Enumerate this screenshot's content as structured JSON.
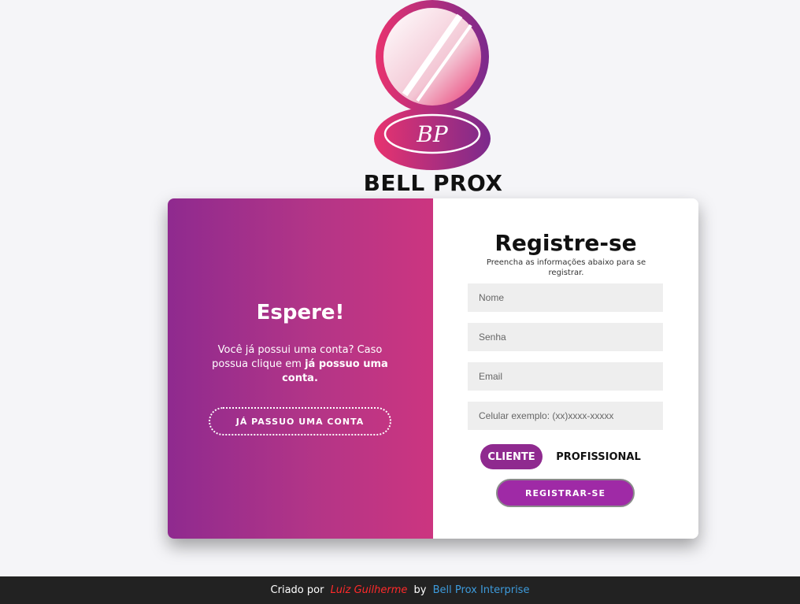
{
  "brand": {
    "name": "BELL PROX",
    "logo_monogram": "BP",
    "colors": {
      "pink": "#e8336f",
      "purple": "#8f2a8f"
    }
  },
  "left_panel": {
    "title": "Espere!",
    "text_pre": "Você já possui uma conta? Caso possua clique em",
    "text_bold": "já possuo uma conta.",
    "button_label": "JÁ PASSUO UMA CONTA"
  },
  "right_panel": {
    "title": "Registre-se",
    "subtitle": "Preencha as informações abaixo para se registrar.",
    "fields": [
      {
        "placeholder": "Nome",
        "value": ""
      },
      {
        "placeholder": "Senha",
        "value": ""
      },
      {
        "placeholder": "Email",
        "value": ""
      },
      {
        "placeholder": "Celular exemplo: (xx)xxxx-xxxxx",
        "value": ""
      }
    ],
    "toggle": {
      "client": "CLIENTE",
      "professional": "PROFISSIONAL",
      "selected": "CLIENTE"
    },
    "submit_label": "REGISTRAR-SE"
  },
  "footer": {
    "prefix": "Criado por",
    "author": "Luiz Guilherme",
    "by": "by",
    "company": "Bell Prox Interprise"
  }
}
